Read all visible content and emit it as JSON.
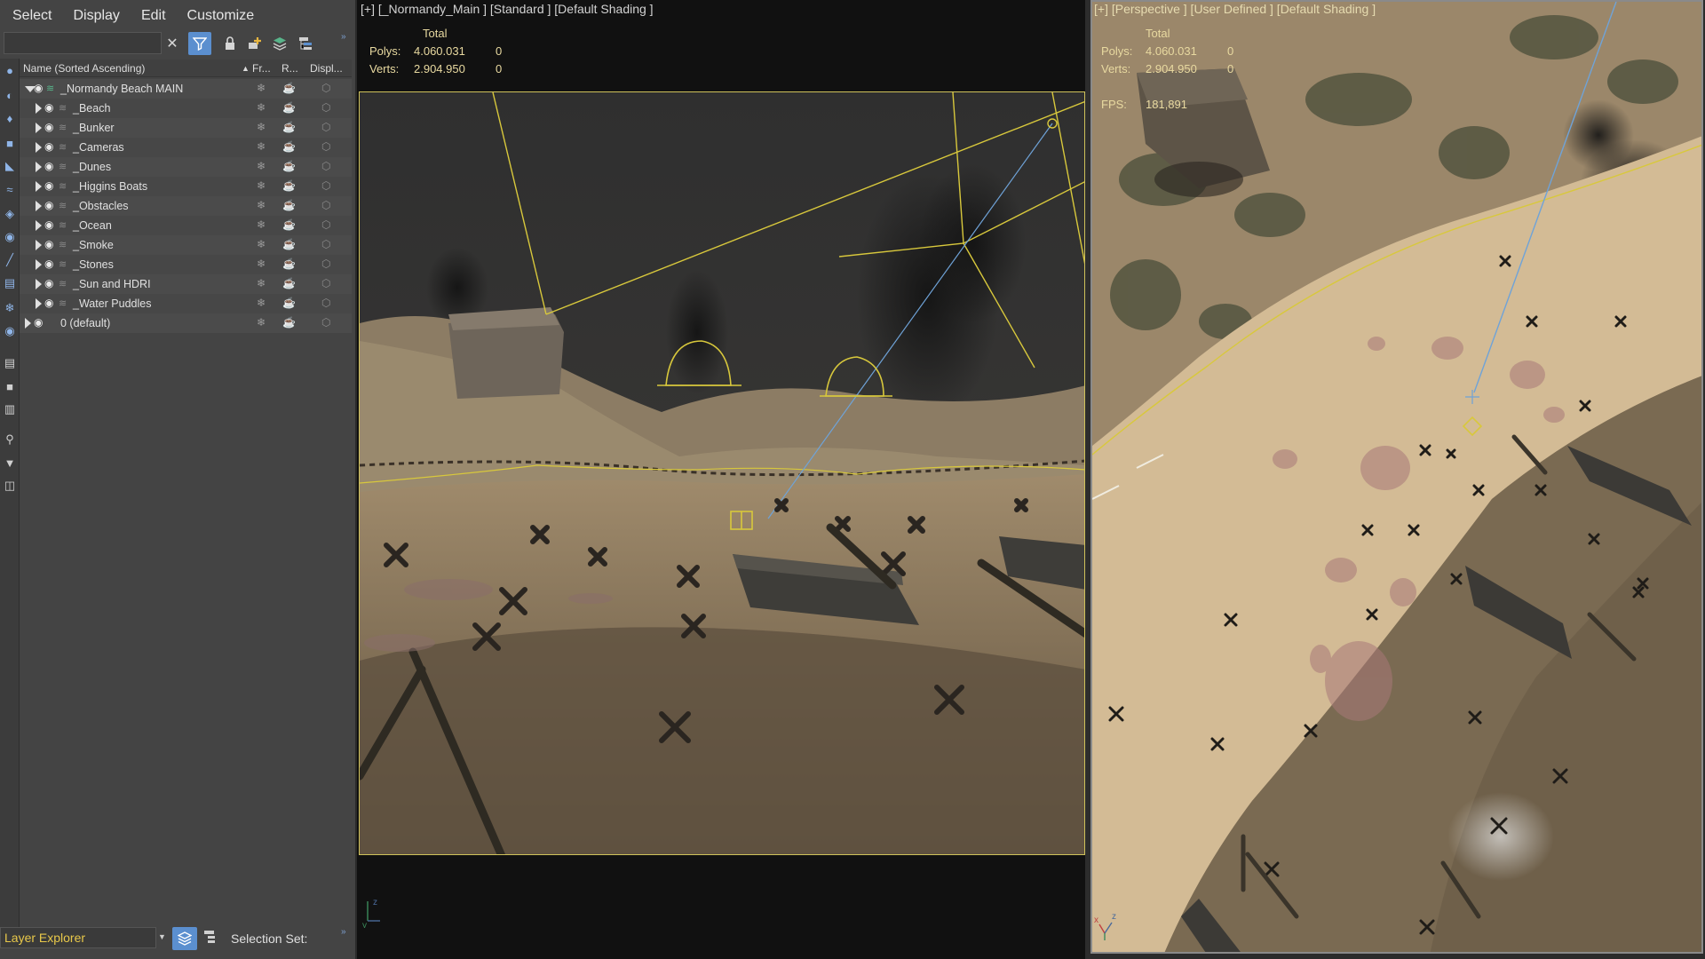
{
  "menu": [
    "Select",
    "Display",
    "Edit",
    "Customize"
  ],
  "toolbar": {
    "search_placeholder": "",
    "clear_glyph": "✕"
  },
  "tree_header": {
    "name": "Name (Sorted Ascending)",
    "sort_glyph": "▲",
    "fr": "Fr...",
    "r": "R...",
    "displ": "Displ..."
  },
  "layers": [
    {
      "label": "_Normandy Beach MAIN",
      "level": 0,
      "open": true,
      "main": true
    },
    {
      "label": "_Beach",
      "level": 1
    },
    {
      "label": "_Bunker",
      "level": 1
    },
    {
      "label": "_Cameras",
      "level": 1
    },
    {
      "label": "_Dunes",
      "level": 1
    },
    {
      "label": "_Higgins Boats",
      "level": 1
    },
    {
      "label": "_Obstacles",
      "level": 1
    },
    {
      "label": "_Ocean",
      "level": 1
    },
    {
      "label": "_Smoke",
      "level": 1
    },
    {
      "label": "_Stones",
      "level": 1
    },
    {
      "label": "_Sun and HDRI",
      "level": 1
    },
    {
      "label": "_Water Puddles",
      "level": 1
    },
    {
      "label": "0 (default)",
      "level": -1
    }
  ],
  "bottom": {
    "explorer": "Layer Explorer",
    "selection_set": "Selection Set:"
  },
  "viewport_main": {
    "title": "[+] [_Normandy_Main ] [Standard ] [Default Shading ]",
    "stats_header": "Total",
    "polys_label": "Polys:",
    "polys": "4.060.031",
    "polys_sel": "0",
    "verts_label": "Verts:",
    "verts": "2.904.950",
    "verts_sel": "0"
  },
  "viewport_persp": {
    "title": "[+] [Perspective ] [User Defined ] [Default Shading ]",
    "stats_header": "Total",
    "polys_label": "Polys:",
    "polys": "4.060.031",
    "polys_sel": "0",
    "verts_label": "Verts:",
    "verts": "2.904.950",
    "verts_sel": "0",
    "fps_label": "FPS:",
    "fps": "181,891"
  },
  "colors": {
    "selection_yellow": "#d8c83c",
    "camera_blue": "#6fa3d8",
    "sand": "#c8ac82",
    "dark_sand": "#6b5b44"
  }
}
